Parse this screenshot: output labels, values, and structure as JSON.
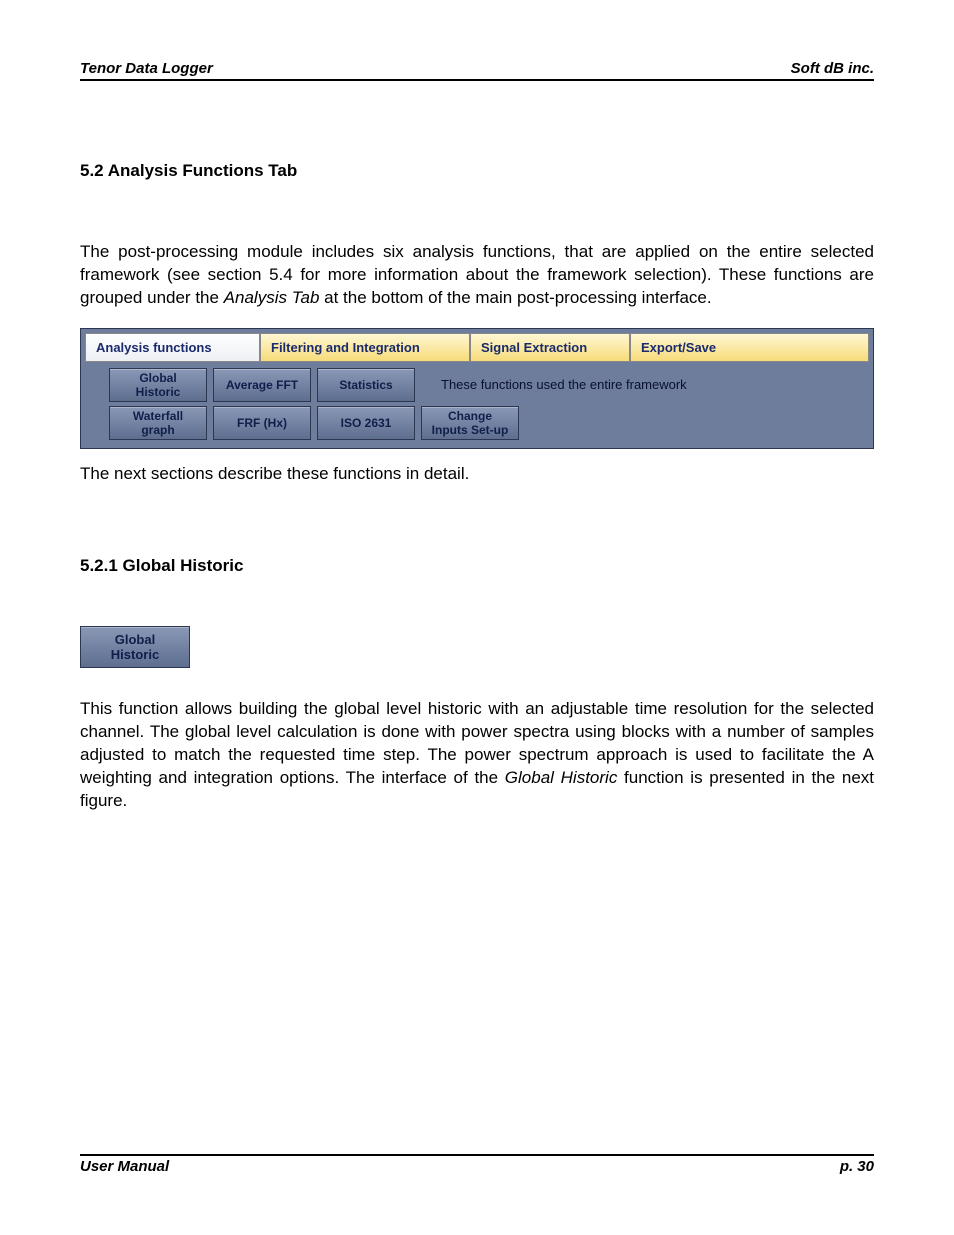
{
  "header": {
    "left": "Tenor Data Logger",
    "right": "Soft dB inc."
  },
  "section": {
    "heading": "5.2 Analysis Functions Tab"
  },
  "para1_a": "The post-processing module includes six analysis functions, that are applied on the entire selected framework (see section 5.4 for more information about the framework selection). These functions are grouped under the ",
  "para1_em": "Analysis Tab",
  "para1_b": " at the bottom of the main post-processing interface.",
  "tabs": {
    "analysis": "Analysis functions",
    "filtering": "Filtering and Integration",
    "signal": "Signal Extraction",
    "export": "Export/Save"
  },
  "buttons": {
    "global_l1": "Global",
    "global_l2": "Historic",
    "avgfft": "Average FFT",
    "stats": "Statistics",
    "waterfall_l1": "Waterfall",
    "waterfall_l2": "graph",
    "frf": "FRF (Hx)",
    "iso": "ISO 2631",
    "change_l1": "Change",
    "change_l2": "Inputs Set-up"
  },
  "panel_note": "These functions used the entire framework",
  "para2": "The next sections describe these functions in detail.",
  "subsection": {
    "heading": "5.2.1 Global Historic"
  },
  "single_button": {
    "l1": "Global",
    "l2": "Historic"
  },
  "para3_a": "This function allows building the global level historic with an adjustable time resolution for the selected channel. The global level calculation is done with power spectra using blocks with a number of samples adjusted to match the requested time step. The power spectrum approach is used to facilitate the A weighting and integration options. The interface of the ",
  "para3_em": "Global Historic",
  "para3_b": " function is presented in the next figure.",
  "footer": {
    "left": "User Manual",
    "right": "p. 30"
  }
}
